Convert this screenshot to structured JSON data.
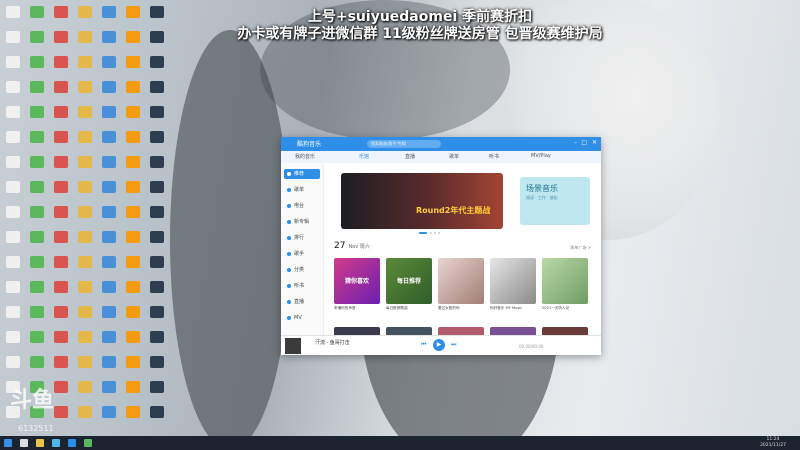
{
  "overlay": {
    "line1": "上号+suiyuedaomei 季前赛折扣",
    "line2": "办卡或有牌子进微信群 11级粉丝牌送房管  包晋级赛维护局"
  },
  "stream": {
    "logo": "斗鱼",
    "room_id": "6132511"
  },
  "window": {
    "brand": "酷狗音乐",
    "search_placeholder": "搜索歌曲/歌手/专辑",
    "tabs": [
      "我的音乐",
      "乐馆",
      "直播",
      "歌单",
      "听书",
      "MV/Play"
    ],
    "sidebar": [
      "推荐",
      "歌单",
      "电台",
      "新专辑",
      "排行",
      "歌手",
      "分类",
      "听书",
      "直播",
      "MV"
    ],
    "banner1_text": "Round2年代主题战",
    "banner2_title": "场景音乐",
    "banner2_sub": "阅读 · 工作 · 放松",
    "section_title": "27",
    "section_sub": "Nov 周六",
    "section_more": "歌单广场 >",
    "cards": [
      {
        "inner": "猜你喜欢",
        "caption": "听懂你的声音"
      },
      {
        "inner": "每日推荐",
        "caption": "每日推荐歌曲"
      },
      {
        "inner": "",
        "caption": "看过太阳的你"
      },
      {
        "inner": "",
        "caption": "你好音乐 MY Music"
      },
      {
        "inner": "",
        "caption": "2021一天听人记"
      }
    ],
    "player": {
      "title": "汗流 · 鱼哥打击",
      "time": "00:00/00:00"
    }
  },
  "taskbar": {
    "time": "11:24",
    "date": "2021/11/27"
  },
  "colors": {
    "accent": "#2f8ee8",
    "taskbar": "#1c2430"
  }
}
